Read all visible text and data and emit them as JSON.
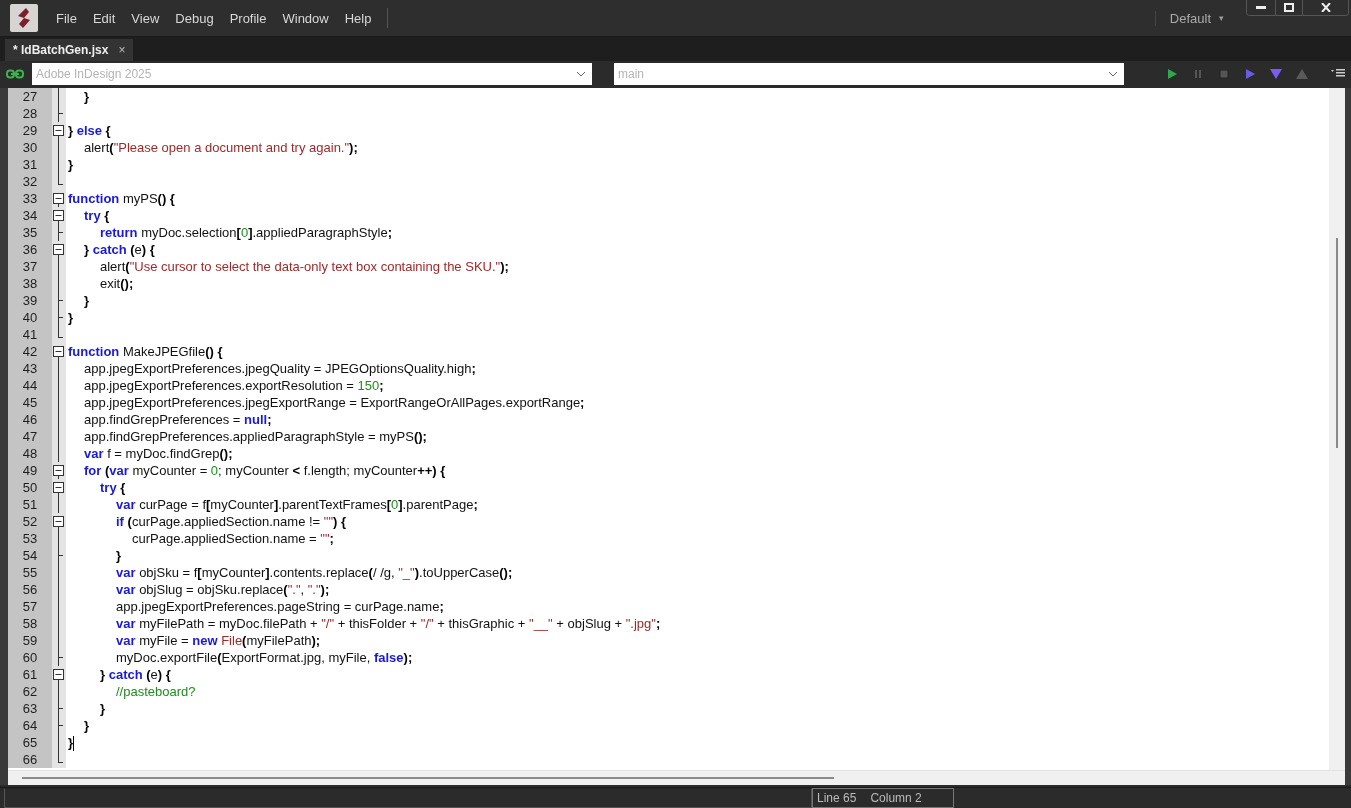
{
  "menu": {
    "items": [
      "File",
      "Edit",
      "View",
      "Debug",
      "Profile",
      "Window",
      "Help"
    ],
    "workspace": "Default",
    "workspace_caret": "▾"
  },
  "tabs": [
    {
      "label": "* IdBatchGen.jsx",
      "selected": true,
      "close": "×"
    }
  ],
  "toolbar": {
    "target": {
      "value": "Adobe InDesign 2025",
      "disabled": true
    },
    "engine": {
      "value": "main",
      "disabled": true
    },
    "buttons": [
      {
        "kind": "run",
        "disabled": false
      },
      {
        "kind": "pause",
        "disabled": true
      },
      {
        "kind": "stop",
        "disabled": true
      },
      {
        "kind": "step-over",
        "disabled": false
      },
      {
        "kind": "step-into",
        "disabled": false
      },
      {
        "kind": "step-out",
        "disabled": true
      }
    ]
  },
  "editor": {
    "lines": [
      {
        "number": "27",
        "kind": "line",
        "cursor": false,
        "tokens": [
          {
            "text": "\t}",
            "kind": "punct"
          }
        ]
      },
      {
        "number": "28",
        "kind": "tick",
        "cursor": false
      },
      {
        "number": "29",
        "kind": "start",
        "cursor": false,
        "tokens": [
          {
            "text": "} ",
            "kind": "punct"
          },
          {
            "text": "else",
            "kind": "keyword"
          },
          {
            "text": " {",
            "kind": "punct"
          }
        ]
      },
      {
        "number": "30",
        "kind": "line",
        "cursor": false,
        "tokens": [
          {
            "text": "\talert",
            "kind": "plain"
          },
          {
            "text": "(",
            "kind": "punct"
          },
          {
            "text": "\"Please open a document and try again.\"",
            "kind": "string"
          },
          {
            "text": ");",
            "kind": "punct"
          }
        ]
      },
      {
        "number": "31",
        "kind": "line",
        "cursor": false,
        "tokens": [
          {
            "text": "}",
            "kind": "punct"
          }
        ]
      },
      {
        "number": "32",
        "kind": "end",
        "cursor": false
      },
      {
        "number": "33",
        "kind": "start",
        "cursor": false,
        "tokens": [
          {
            "text": "function",
            "kind": "keyword"
          },
          {
            "text": " myPS",
            "kind": "plain"
          },
          {
            "text": "() {",
            "kind": "punct"
          }
        ]
      },
      {
        "number": "34",
        "kind": "start",
        "cursor": false,
        "tokens": [
          {
            "text": "\ttry",
            "kind": "keyword"
          },
          {
            "text": " {",
            "kind": "punct"
          }
        ]
      },
      {
        "number": "35",
        "kind": "tick",
        "cursor": false,
        "tokens": [
          {
            "text": "\t\treturn",
            "kind": "keyword"
          },
          {
            "text": " myDoc.selection",
            "kind": "plain"
          },
          {
            "text": "[",
            "kind": "punct"
          },
          {
            "text": "0",
            "kind": "number"
          },
          {
            "text": "]",
            "kind": "punct"
          },
          {
            "text": ".appliedParagraphStyle",
            "kind": "plain"
          },
          {
            "text": ";",
            "kind": "punct"
          }
        ]
      },
      {
        "number": "36",
        "kind": "start",
        "cursor": false,
        "tokens": [
          {
            "text": "\t} ",
            "kind": "punct"
          },
          {
            "text": "catch",
            "kind": "keyword"
          },
          {
            "text": " (",
            "kind": "punct"
          },
          {
            "text": "e",
            "kind": "plain"
          },
          {
            "text": ") {",
            "kind": "punct"
          }
        ]
      },
      {
        "number": "37",
        "kind": "line",
        "cursor": false,
        "tokens": [
          {
            "text": "\t\talert",
            "kind": "plain"
          },
          {
            "text": "(",
            "kind": "punct"
          },
          {
            "text": "\"Use cursor to select the data-only text box containing the SKU.\"",
            "kind": "string"
          },
          {
            "text": ");",
            "kind": "punct"
          }
        ]
      },
      {
        "number": "38",
        "kind": "line",
        "cursor": false,
        "tokens": [
          {
            "text": "\t\texit",
            "kind": "plain"
          },
          {
            "text": "();",
            "kind": "punct"
          }
        ]
      },
      {
        "number": "39",
        "kind": "tick",
        "cursor": false,
        "tokens": [
          {
            "text": "\t}",
            "kind": "punct"
          }
        ]
      },
      {
        "number": "40",
        "kind": "tick",
        "cursor": false,
        "tokens": [
          {
            "text": "}",
            "kind": "punct"
          }
        ]
      },
      {
        "number": "41",
        "kind": "end",
        "cursor": false
      },
      {
        "number": "42",
        "kind": "start",
        "cursor": false,
        "tokens": [
          {
            "text": "function",
            "kind": "keyword"
          },
          {
            "text": " MakeJPEGfile",
            "kind": "plain"
          },
          {
            "text": "() {",
            "kind": "punct"
          }
        ]
      },
      {
        "number": "43",
        "kind": "line",
        "cursor": false,
        "tokens": [
          {
            "text": "\tapp.jpegExportPreferences.jpegQuality = JPEGOptionsQuality.high",
            "kind": "plain"
          },
          {
            "text": ";",
            "kind": "punct"
          }
        ]
      },
      {
        "number": "44",
        "kind": "line",
        "cursor": false,
        "tokens": [
          {
            "text": "\tapp.jpegExportPreferences.exportResolution = ",
            "kind": "plain"
          },
          {
            "text": "150",
            "kind": "number"
          },
          {
            "text": ";",
            "kind": "punct"
          }
        ]
      },
      {
        "number": "45",
        "kind": "line",
        "cursor": false,
        "tokens": [
          {
            "text": "\tapp.jpegExportPreferences.jpegExportRange = ExportRangeOrAllPages.exportRange",
            "kind": "plain"
          },
          {
            "text": ";",
            "kind": "punct"
          }
        ]
      },
      {
        "number": "46",
        "kind": "line",
        "cursor": false,
        "tokens": [
          {
            "text": "\tapp.findGrepPreferences = ",
            "kind": "plain"
          },
          {
            "text": "null",
            "kind": "keyword"
          },
          {
            "text": ";",
            "kind": "punct"
          }
        ]
      },
      {
        "number": "47",
        "kind": "line",
        "cursor": false,
        "tokens": [
          {
            "text": "\tapp.findGrepPreferences.appliedParagraphStyle = myPS",
            "kind": "plain"
          },
          {
            "text": "();",
            "kind": "punct"
          }
        ]
      },
      {
        "number": "48",
        "kind": "line",
        "cursor": false,
        "tokens": [
          {
            "text": "\tvar",
            "kind": "keyword"
          },
          {
            "text": " f = myDoc.findGrep",
            "kind": "plain"
          },
          {
            "text": "();",
            "kind": "punct"
          }
        ]
      },
      {
        "number": "49",
        "kind": "start",
        "cursor": false,
        "tokens": [
          {
            "text": "\tfor",
            "kind": "keyword"
          },
          {
            "text": " (",
            "kind": "punct"
          },
          {
            "text": "var",
            "kind": "keyword"
          },
          {
            "text": " myCounter = ",
            "kind": "plain"
          },
          {
            "text": "0",
            "kind": "number"
          },
          {
            "text": "; myCounter ",
            "kind": "plain"
          },
          {
            "text": "<",
            "kind": "punct"
          },
          {
            "text": " f.length; myCounter",
            "kind": "plain"
          },
          {
            "text": "++) {",
            "kind": "punct"
          }
        ]
      },
      {
        "number": "50",
        "kind": "start",
        "cursor": false,
        "tokens": [
          {
            "text": "\t\ttry",
            "kind": "keyword"
          },
          {
            "text": " {",
            "kind": "punct"
          }
        ]
      },
      {
        "number": "51",
        "kind": "line",
        "cursor": false,
        "tokens": [
          {
            "text": "\t\t\tvar",
            "kind": "keyword"
          },
          {
            "text": " curPage = f",
            "kind": "plain"
          },
          {
            "text": "[",
            "kind": "punct"
          },
          {
            "text": "myCounter",
            "kind": "plain"
          },
          {
            "text": "]",
            "kind": "punct"
          },
          {
            "text": ".parentTextFrames",
            "kind": "plain"
          },
          {
            "text": "[",
            "kind": "punct"
          },
          {
            "text": "0",
            "kind": "number"
          },
          {
            "text": "]",
            "kind": "punct"
          },
          {
            "text": ".parentPage",
            "kind": "plain"
          },
          {
            "text": ";",
            "kind": "punct"
          }
        ]
      },
      {
        "number": "52",
        "kind": "start",
        "cursor": false,
        "tokens": [
          {
            "text": "\t\t\tif",
            "kind": "keyword"
          },
          {
            "text": " (",
            "kind": "punct"
          },
          {
            "text": "curPage.appliedSection.name != ",
            "kind": "plain"
          },
          {
            "text": "\"\"",
            "kind": "string"
          },
          {
            "text": ") {",
            "kind": "punct"
          }
        ]
      },
      {
        "number": "53",
        "kind": "line",
        "cursor": false,
        "tokens": [
          {
            "text": "\t\t\t\tcurPage.appliedSection.name = ",
            "kind": "plain"
          },
          {
            "text": "\"\"",
            "kind": "string"
          },
          {
            "text": ";",
            "kind": "punct"
          }
        ]
      },
      {
        "number": "54",
        "kind": "tick",
        "cursor": false,
        "tokens": [
          {
            "text": "\t\t\t}",
            "kind": "punct"
          }
        ]
      },
      {
        "number": "55",
        "kind": "line",
        "cursor": false,
        "tokens": [
          {
            "text": "\t\t\tvar",
            "kind": "keyword"
          },
          {
            "text": " objSku = f",
            "kind": "plain"
          },
          {
            "text": "[",
            "kind": "punct"
          },
          {
            "text": "myCounter",
            "kind": "plain"
          },
          {
            "text": "]",
            "kind": "punct"
          },
          {
            "text": ".contents.replace",
            "kind": "plain"
          },
          {
            "text": "(",
            "kind": "punct"
          },
          {
            "text": "/ /g, ",
            "kind": "plain"
          },
          {
            "text": "\"_\"",
            "kind": "string"
          },
          {
            "text": ")",
            "kind": "punct"
          },
          {
            "text": ".toUpperCase",
            "kind": "plain"
          },
          {
            "text": "();",
            "kind": "punct"
          }
        ]
      },
      {
        "number": "56",
        "kind": "line",
        "cursor": false,
        "tokens": [
          {
            "text": "\t\t\tvar",
            "kind": "keyword"
          },
          {
            "text": " objSlug = objSku.replace",
            "kind": "plain"
          },
          {
            "text": "(",
            "kind": "punct"
          },
          {
            "text": "\".\"",
            "kind": "string"
          },
          {
            "text": ", ",
            "kind": "plain"
          },
          {
            "text": "\".\"",
            "kind": "string"
          },
          {
            "text": ");",
            "kind": "punct"
          }
        ]
      },
      {
        "number": "57",
        "kind": "line",
        "cursor": false,
        "tokens": [
          {
            "text": "\t\t\tapp.jpegExportPreferences.pageString = curPage.name",
            "kind": "plain"
          },
          {
            "text": ";",
            "kind": "punct"
          }
        ]
      },
      {
        "number": "58",
        "kind": "line",
        "cursor": false,
        "tokens": [
          {
            "text": "\t\t\tvar",
            "kind": "keyword"
          },
          {
            "text": " myFilePath = myDoc.filePath + ",
            "kind": "plain"
          },
          {
            "text": "\"/\"",
            "kind": "string"
          },
          {
            "text": " + thisFolder + ",
            "kind": "plain"
          },
          {
            "text": "\"/\"",
            "kind": "string"
          },
          {
            "text": " + thisGraphic + ",
            "kind": "plain"
          },
          {
            "text": "\"__\"",
            "kind": "string"
          },
          {
            "text": " + objSlug + ",
            "kind": "plain"
          },
          {
            "text": "\".jpg\"",
            "kind": "string"
          },
          {
            "text": ";",
            "kind": "punct"
          }
        ]
      },
      {
        "number": "59",
        "kind": "line",
        "cursor": false,
        "tokens": [
          {
            "text": "\t\t\tvar",
            "kind": "keyword"
          },
          {
            "text": " myFile = ",
            "kind": "plain"
          },
          {
            "text": "new",
            "kind": "keyword"
          },
          {
            "text": " File",
            "kind": "class"
          },
          {
            "text": "(",
            "kind": "punct"
          },
          {
            "text": "myFilePath",
            "kind": "plain"
          },
          {
            "text": ");",
            "kind": "punct"
          }
        ]
      },
      {
        "number": "60",
        "kind": "tick",
        "cursor": false,
        "tokens": [
          {
            "text": "\t\t\tmyDoc.exportFile",
            "kind": "plain"
          },
          {
            "text": "(",
            "kind": "punct"
          },
          {
            "text": "ExportFormat.jpg, myFile, ",
            "kind": "plain"
          },
          {
            "text": "false",
            "kind": "keyword"
          },
          {
            "text": ");",
            "kind": "punct"
          }
        ]
      },
      {
        "number": "61",
        "kind": "start",
        "cursor": false,
        "tokens": [
          {
            "text": "\t\t} ",
            "kind": "punct"
          },
          {
            "text": "catch",
            "kind": "keyword"
          },
          {
            "text": " (",
            "kind": "punct"
          },
          {
            "text": "e",
            "kind": "plain"
          },
          {
            "text": ") {",
            "kind": "punct"
          }
        ]
      },
      {
        "number": "62",
        "kind": "line",
        "cursor": false,
        "tokens": [
          {
            "text": "\t\t\t//pasteboard?",
            "kind": "comment"
          }
        ]
      },
      {
        "number": "63",
        "kind": "tick",
        "cursor": false,
        "tokens": [
          {
            "text": "\t\t}",
            "kind": "punct"
          }
        ]
      },
      {
        "number": "64",
        "kind": "tick",
        "cursor": false,
        "tokens": [
          {
            "text": "\t}",
            "kind": "punct"
          }
        ]
      },
      {
        "number": "65",
        "kind": "line",
        "cursor": true,
        "tokens": [
          {
            "text": "}",
            "kind": "punct"
          }
        ]
      },
      {
        "number": "66",
        "kind": "end",
        "cursor": false
      }
    ]
  },
  "status_bar": {
    "line": "Line 65",
    "column": "Column 2"
  }
}
